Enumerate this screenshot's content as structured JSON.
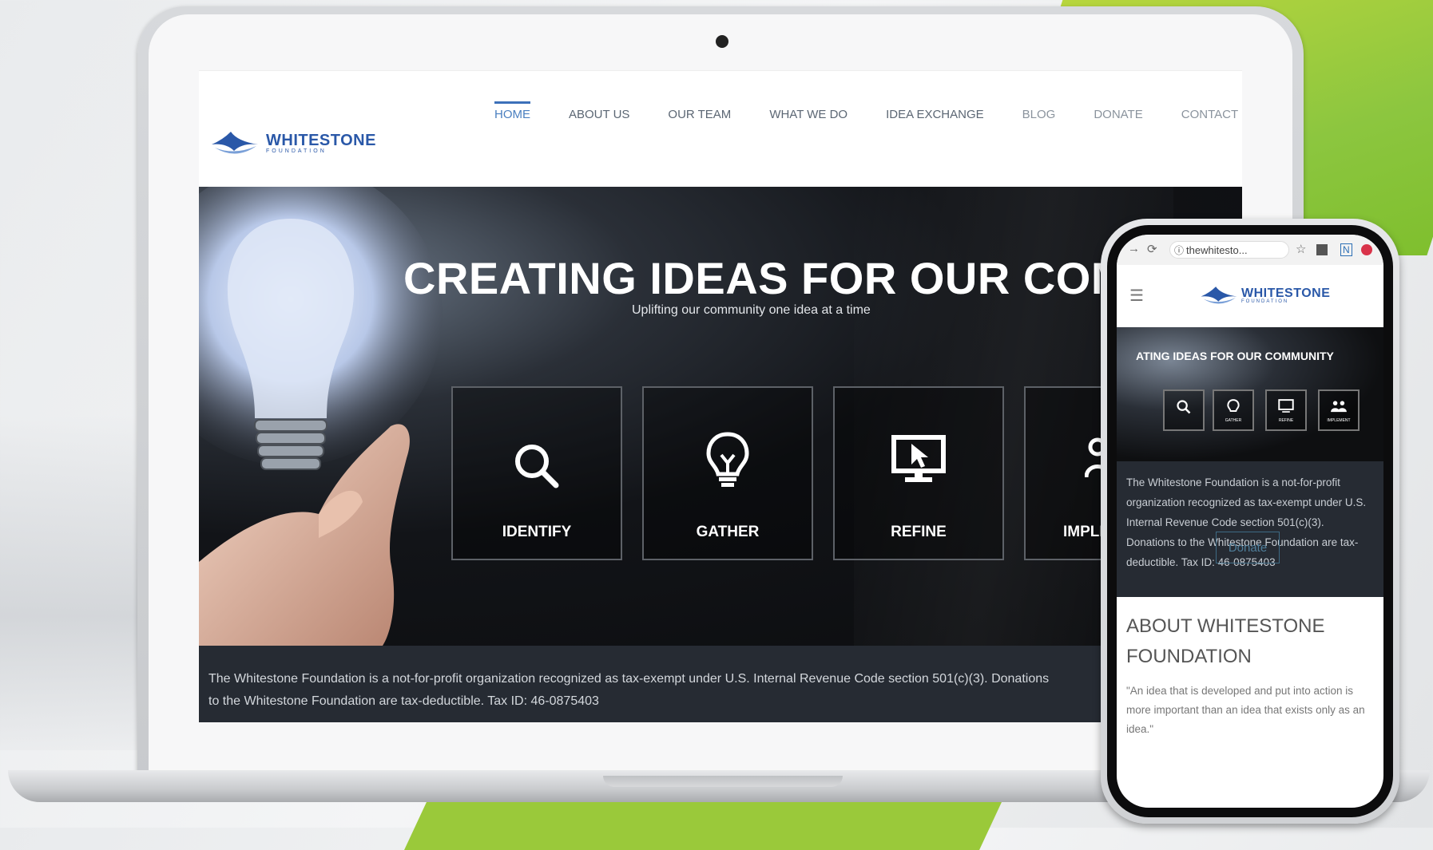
{
  "site": {
    "logo": {
      "name": "WHITESTONE",
      "sub": "FOUNDATION"
    },
    "nav": [
      {
        "label": "HOME",
        "active": true
      },
      {
        "label": "ABOUT US"
      },
      {
        "label": "OUR TEAM"
      },
      {
        "label": "WHAT WE DO"
      },
      {
        "label": "IDEA EXCHANGE"
      },
      {
        "label": "BLOG"
      },
      {
        "label": "DONATE"
      },
      {
        "label": "CONTACT"
      }
    ],
    "hero": {
      "title": "CREATING IDEAS FOR OUR COMI",
      "subtitle": "Uplifting our community one idea at a time",
      "steps": [
        {
          "label": "IDENTIFY",
          "icon": "search-icon"
        },
        {
          "label": "GATHER",
          "icon": "lightbulb-icon"
        },
        {
          "label": "REFINE",
          "icon": "monitor-cursor-icon"
        },
        {
          "label": "IMPLI",
          "icon": "people-icon"
        }
      ]
    },
    "info": "The Whitestone Foundation is a not-for-profit organization recognized as tax-exempt under U.S. Internal Revenue Code section 501(c)(3). Donations to the Whitestone Foundation are tax-deductible. Tax ID: 46-0875403"
  },
  "mobile": {
    "url": "thewhitesto...",
    "logo": {
      "name": "WHITESTONE",
      "sub": "FOUNDATION"
    },
    "hero_title": "ATING IDEAS FOR OUR COMMUNITY",
    "boxes": [
      {
        "label": "",
        "icon": "search-icon"
      },
      {
        "label": "GATHER",
        "icon": "lightbulb-icon"
      },
      {
        "label": "REFINE",
        "icon": "monitor-cursor-icon"
      },
      {
        "label": "IMPLEMENT",
        "icon": "people-icon"
      }
    ],
    "info": "The Whitestone Foundation is a not-for-profit organization recognized as tax-exempt under U.S. Internal Revenue Code section 501(c)(3). Donations to the Whitestone Foundation are tax-deductible. Tax ID: 46-0875403",
    "donate_label": "Donate",
    "about_title": "ABOUT WHITESTONE FOUNDATION",
    "quote": "\"An idea that is developed and put into action is more important than an idea that exists only as an idea.\""
  },
  "colors": {
    "brand_blue": "#2a58a8",
    "nav_active": "#3c70b9",
    "info_bg": "#262b33",
    "accent_green": "#8cc63f"
  }
}
